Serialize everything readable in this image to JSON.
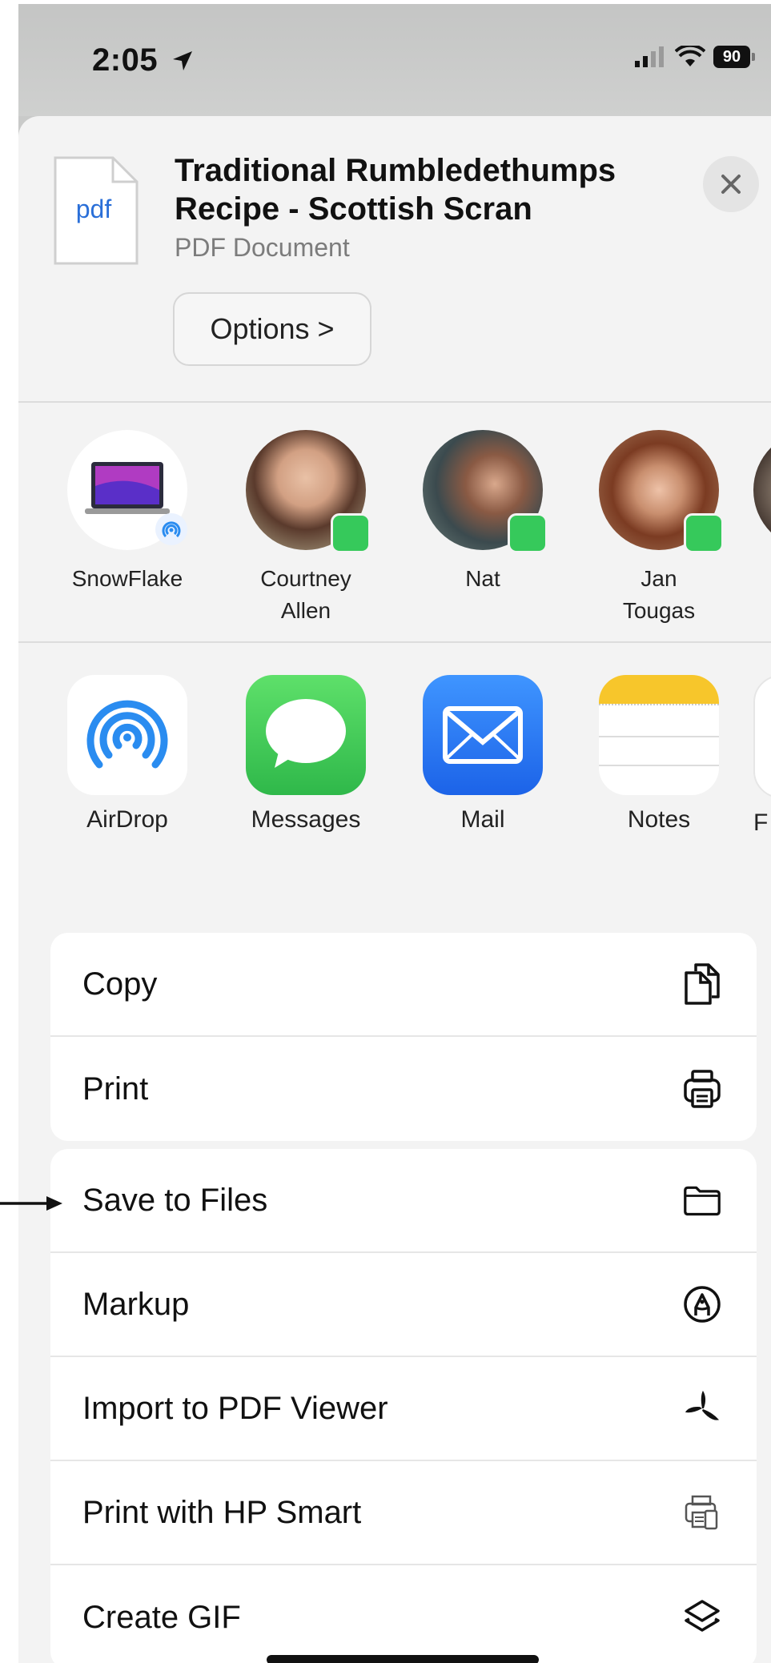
{
  "status_bar": {
    "time": "2:05",
    "battery": "90"
  },
  "share_header": {
    "doc_type_icon": "pdf",
    "title_line1": "Traditional Rumbledethumps",
    "title_line2": "Recipe - Scottish Scran",
    "subtitle": "PDF Document",
    "options_label": "Options >"
  },
  "people": [
    {
      "name": "SnowFlake",
      "name2": "",
      "kind": "device"
    },
    {
      "name": "Courtney",
      "name2": "Allen",
      "kind": "contact"
    },
    {
      "name": "Nat",
      "name2": "",
      "kind": "contact"
    },
    {
      "name": "Jan",
      "name2": "Tougas",
      "kind": "contact"
    }
  ],
  "apps": [
    {
      "name": "AirDrop",
      "icon": "airdrop-icon"
    },
    {
      "name": "Messages",
      "icon": "messages-icon"
    },
    {
      "name": "Mail",
      "icon": "mail-icon"
    },
    {
      "name": "Notes",
      "icon": "notes-icon"
    },
    {
      "name": "F",
      "icon": "partial-app-icon"
    }
  ],
  "actions_group1": [
    {
      "label": "Copy",
      "icon": "copy-icon"
    },
    {
      "label": "Print",
      "icon": "printer-icon"
    }
  ],
  "actions_group2": [
    {
      "label": "Save to Files",
      "icon": "folder-icon"
    },
    {
      "label": "Markup",
      "icon": "markup-icon"
    },
    {
      "label": "Import to PDF Viewer",
      "icon": "pdf-viewer-icon"
    },
    {
      "label": "Print with HP Smart",
      "icon": "hp-smart-icon"
    },
    {
      "label": "Create GIF",
      "icon": "layers-icon"
    }
  ],
  "colors": {
    "messages_green": "#36c95b",
    "mail_blue": "#2f7af5",
    "airdrop_blue": "#2a8cf0",
    "notes_yellow": "#f7c62b"
  }
}
